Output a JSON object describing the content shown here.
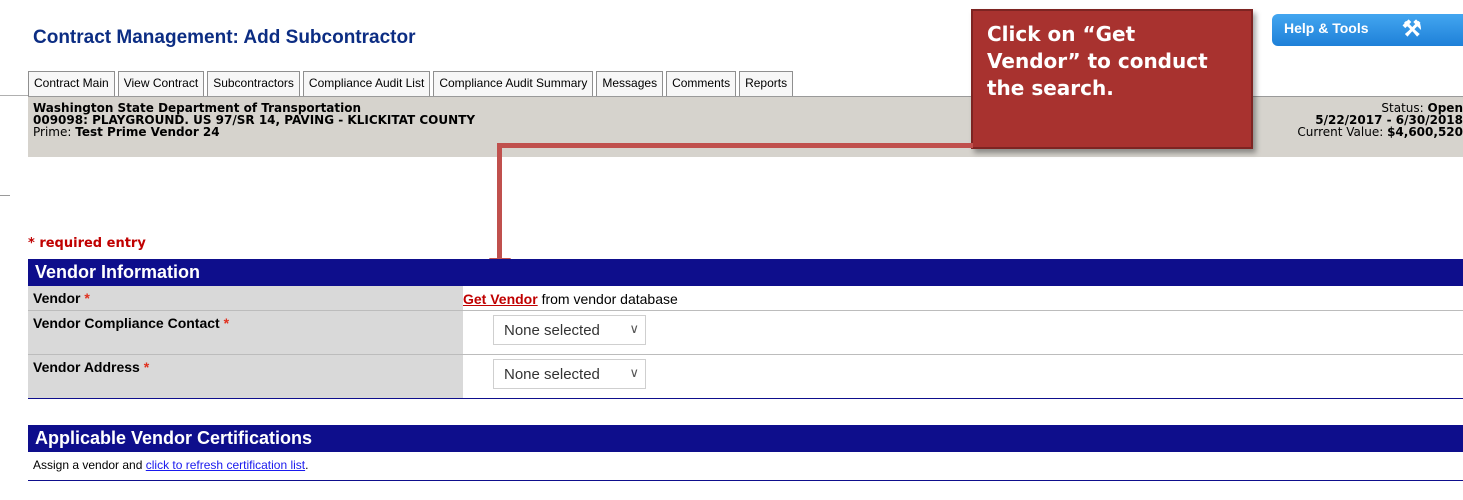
{
  "page": {
    "title": "Contract Management: Add Subcontractor"
  },
  "help": {
    "label": "Help & Tools",
    "icon": "tools-icon"
  },
  "tabs": [
    {
      "label": "Contract Main"
    },
    {
      "label": "View Contract"
    },
    {
      "label": "Subcontractors"
    },
    {
      "label": "Compliance Audit List"
    },
    {
      "label": "Compliance Audit Summary"
    },
    {
      "label": "Messages"
    },
    {
      "label": "Comments"
    },
    {
      "label": "Reports"
    }
  ],
  "contract": {
    "agency": "Washington State Department of Transportation",
    "number_title": "009098: PLAYGROUND. US 97/SR 14, PAVING - KLICKITAT COUNTY",
    "prime_label": "Prime:",
    "prime_value": "Test Prime Vendor 24",
    "status_label": "Status:",
    "status_value": "Open",
    "date_range": "5/22/2017 - 6/30/2018",
    "current_value_label": "Current Value:",
    "current_value": "$4,600,520"
  },
  "callout": {
    "line1": "Click on “Get",
    "line2": "Vendor” to conduct",
    "line3": "the search."
  },
  "form": {
    "required_note": "* required entry",
    "vendor_section_title": "Vendor Information",
    "vendor_label": "Vendor",
    "star": "*",
    "get_vendor_link": "Get Vendor",
    "get_vendor_suffix": " from vendor database",
    "compliance_contact_label": "Vendor Compliance Contact",
    "compliance_contact_value": "None selected",
    "address_label": "Vendor Address",
    "address_value": "None selected"
  },
  "certs": {
    "section_title": "Applicable Vendor Certifications",
    "text_prefix": "Assign a vendor and ",
    "refresh_link": "click to refresh certification list",
    "text_suffix": "."
  },
  "colors": {
    "title": "#0c2d83",
    "section_bar": "#0e0e8c",
    "callout": "#a8322f",
    "arrow": "#c0504d",
    "required": "#c00000"
  }
}
